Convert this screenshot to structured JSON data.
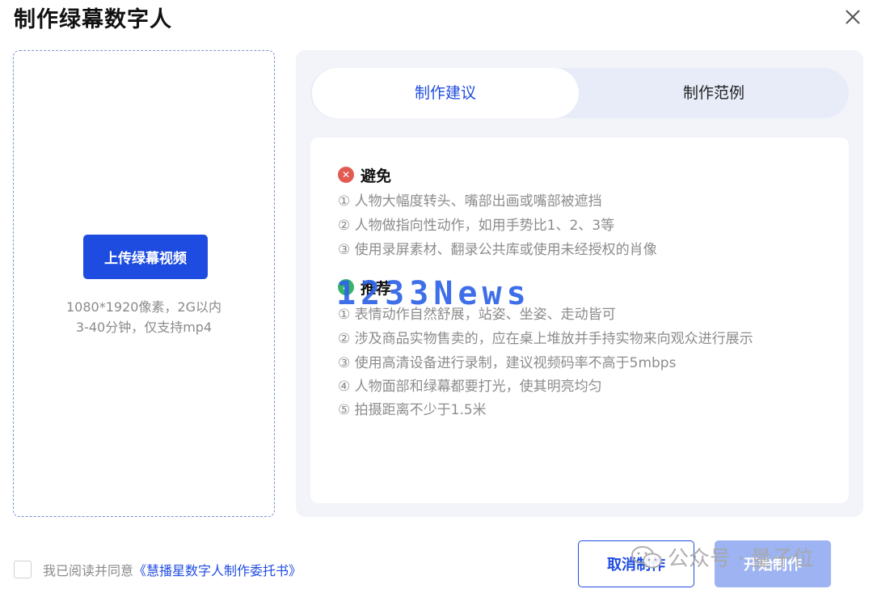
{
  "dialog": {
    "title": "制作绿幕数字人"
  },
  "upload": {
    "button_label": "上传绿幕视频",
    "hint_line1": "1080*1920像素，2G以内",
    "hint_line2": "3-40分钟，仅支持mp4"
  },
  "tabs": [
    {
      "label": "制作建议",
      "active": true
    },
    {
      "label": "制作范例",
      "active": false
    }
  ],
  "avoid": {
    "title": "避免",
    "icon": "x-circle-icon",
    "items": [
      "① 人物大幅度转头、嘴部出画或嘴部被遮挡",
      "② 人物做指向性动作，如用手势比1、2、3等",
      "③ 使用录屏素材、翻录公共库或使用未经授权的肖像"
    ]
  },
  "recommend": {
    "title": "推荐",
    "icon": "check-circle-icon",
    "items": [
      "① 表情动作自然舒展，站姿、坐姿、走动皆可",
      "② 涉及商品实物售卖的，应在桌上堆放并手持实物来向观众进行展示",
      "③ 使用高清设备进行录制，建议视频码率不高于5mbps",
      "④ 人物面部和绿幕都要打光，使其明亮均匀",
      "⑤ 拍摄距离不少于1.5米"
    ]
  },
  "footer": {
    "agree_prefix": "我已阅读并同意",
    "agree_link": "《慧播星数字人制作委托书》",
    "cancel_label": "取消制作",
    "start_label": "开始制作"
  },
  "watermarks": {
    "overlay_text": "1233News",
    "wechat_text": "公众号 · 量子位"
  },
  "colors": {
    "primary": "#1f4ce0",
    "disabled_primary": "#9db3f2",
    "avoid_icon": "#e25b52",
    "recommend_icon": "#39b36b"
  }
}
